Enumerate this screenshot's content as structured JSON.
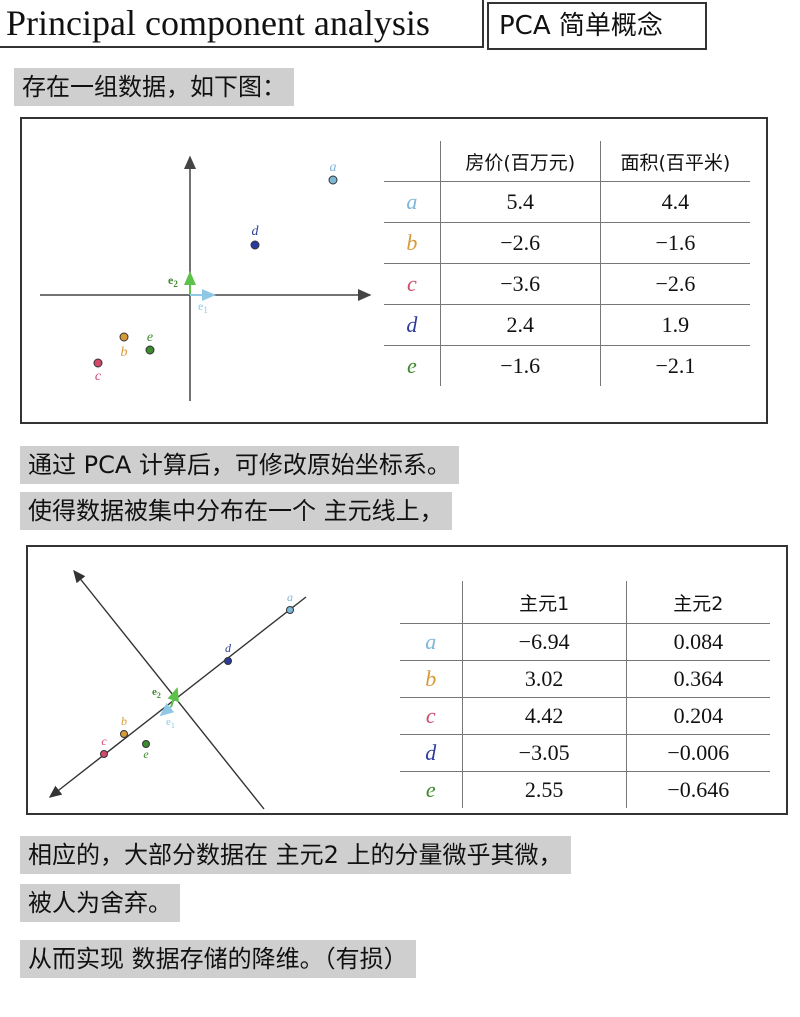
{
  "title": "Principal component analysis",
  "subtitle": "PCA 简单概念",
  "notes": {
    "intro": "存在一组数据，如下图：",
    "pca_line1": "通过  PCA  计算后，可修改原始坐标系。",
    "pca_line2": "使得数据被集中分布在一个  主元线上，",
    "result_line1": "相应的，大部分数据在  主元2  上的分量微乎其微，",
    "result_line2": "被人为舍弃。",
    "conclusion": "从而实现  数据存储的降维。（有损）"
  },
  "colors": {
    "a": "#7fb7d9",
    "b": "#d69a3a",
    "c": "#d04a6a",
    "d": "#2b3a9e",
    "e": "#3f8a2e",
    "axis_e1": "#8fc8e6",
    "axis_e2": "#5cc24a",
    "note_bg": "#cfcfcf"
  },
  "table1": {
    "headers": [
      "",
      "房价(百万元)",
      "面积(百平米)"
    ],
    "rows": [
      {
        "label": "a",
        "v1": "5.4",
        "v2": "4.4"
      },
      {
        "label": "b",
        "v1": "−2.6",
        "v2": "−1.6"
      },
      {
        "label": "c",
        "v1": "−3.6",
        "v2": "−2.6"
      },
      {
        "label": "d",
        "v1": "2.4",
        "v2": "1.9"
      },
      {
        "label": "e",
        "v1": "−1.6",
        "v2": "−2.1"
      }
    ]
  },
  "table2": {
    "headers": [
      "",
      "主元1",
      "主元2"
    ],
    "rows": [
      {
        "label": "a",
        "v1": "−6.94",
        "v2": "0.084"
      },
      {
        "label": "b",
        "v1": "3.02",
        "v2": "0.364"
      },
      {
        "label": "c",
        "v1": "4.42",
        "v2": "0.204"
      },
      {
        "label": "d",
        "v1": "−3.05",
        "v2": "−0.006"
      },
      {
        "label": "e",
        "v1": "2.55",
        "v2": "−0.646"
      }
    ]
  },
  "plot_labels": {
    "points": [
      "a",
      "b",
      "c",
      "d",
      "e"
    ],
    "e1": "e",
    "e1_sub": "1",
    "e2": "e",
    "e2_sub": "2"
  }
}
